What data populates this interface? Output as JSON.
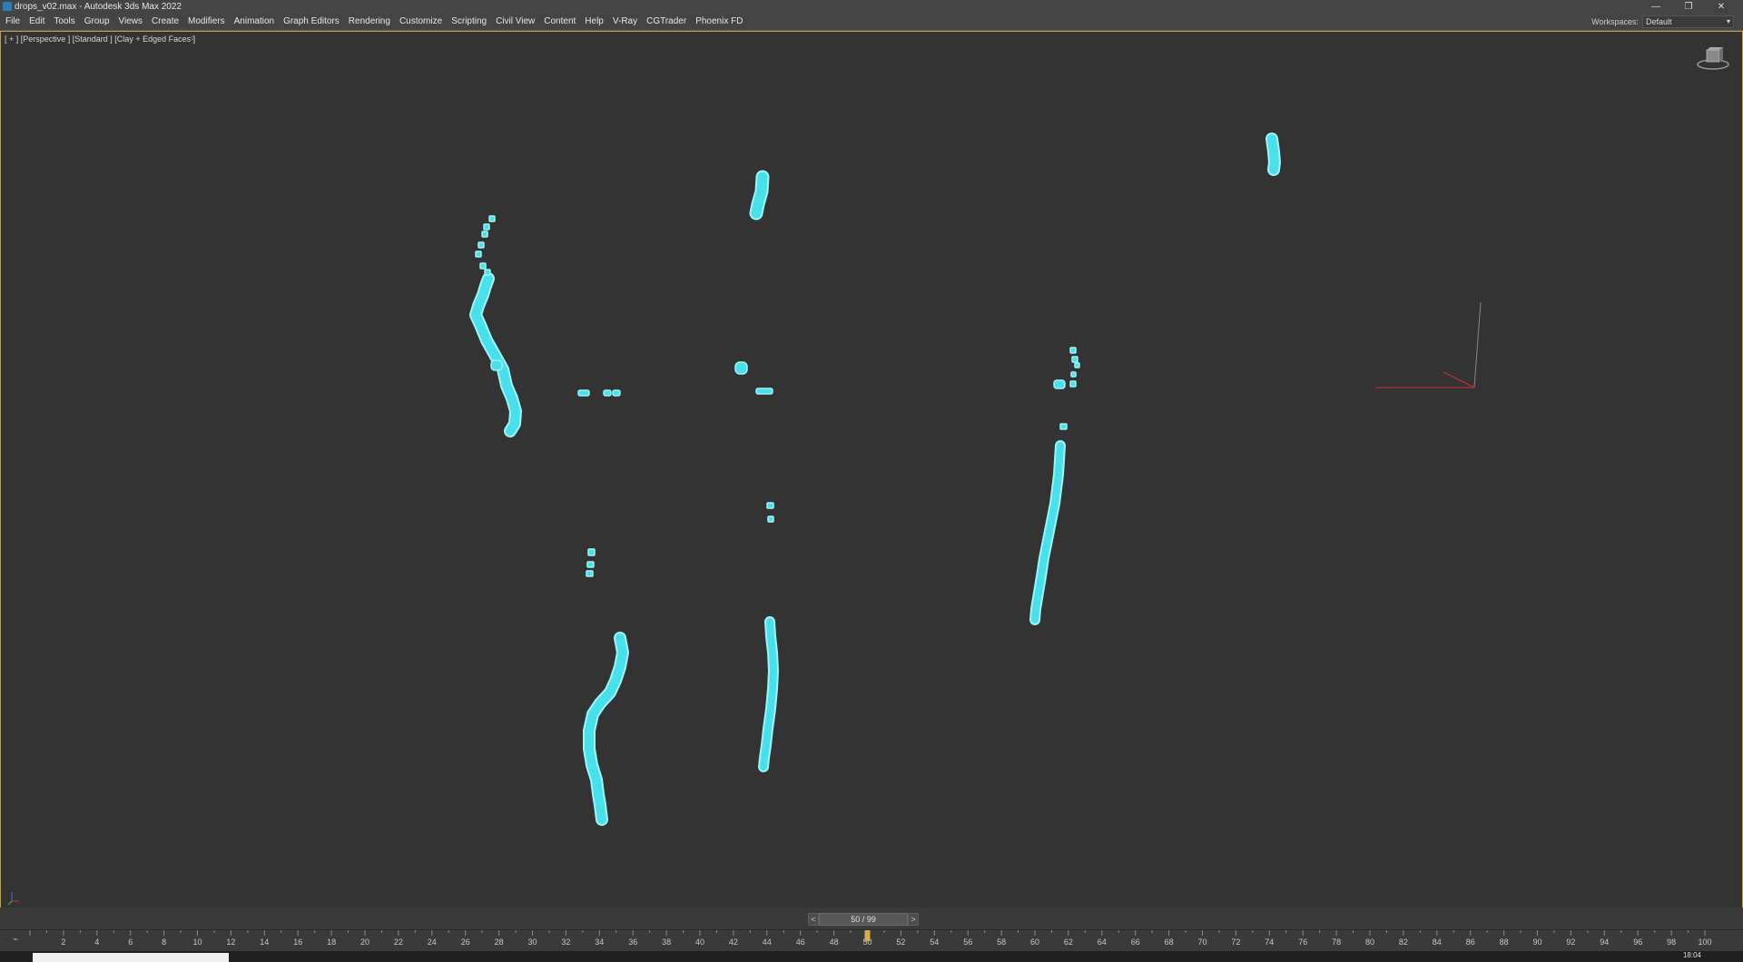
{
  "window": {
    "title": "drops_v02.max - Autodesk 3ds Max 2022",
    "controls": [
      "—",
      "❐",
      "✕"
    ]
  },
  "menu": {
    "items": [
      "File",
      "Edit",
      "Tools",
      "Group",
      "Views",
      "Create",
      "Modifiers",
      "Animation",
      "Graph Editors",
      "Rendering",
      "Customize",
      "Scripting",
      "Civil View",
      "Content",
      "Help",
      "V-Ray",
      "CGTrader",
      "Phoenix FD"
    ]
  },
  "workspace": {
    "label": "Workspaces:",
    "value": "Default"
  },
  "viewport": {
    "label": "[ + ] [Perspective ] [Standard ] [Clay + Edged Faces ]",
    "filter_icon": "funnel-icon",
    "viewcube_icon": "viewcube-icon"
  },
  "colors": {
    "selection": "#48e0ea",
    "selection_outline": "#9ff4f8",
    "viewport_bg": "#333333",
    "active_border": "#c8a040",
    "axis_x": "#c83030",
    "axis_z": "#888888"
  },
  "timeline": {
    "frame_readout": "50 / 99",
    "prev": "<",
    "next": ">",
    "current_frame": 50,
    "tick_labels": [
      "2",
      "4",
      "6",
      "8",
      "10",
      "12",
      "14",
      "16",
      "18",
      "20",
      "22",
      "24",
      "26",
      "28",
      "30",
      "32",
      "34",
      "36",
      "38",
      "40",
      "42",
      "44",
      "46",
      "48",
      "50",
      "52",
      "54",
      "56",
      "58",
      "60",
      "62",
      "64",
      "66",
      "68",
      "70",
      "72",
      "74",
      "76",
      "78",
      "80",
      "82",
      "84",
      "86",
      "88",
      "90",
      "92",
      "94",
      "96",
      "98",
      "100"
    ],
    "track_icon": "key-filter-icon"
  },
  "taskbar": {
    "clock": "18:04"
  }
}
